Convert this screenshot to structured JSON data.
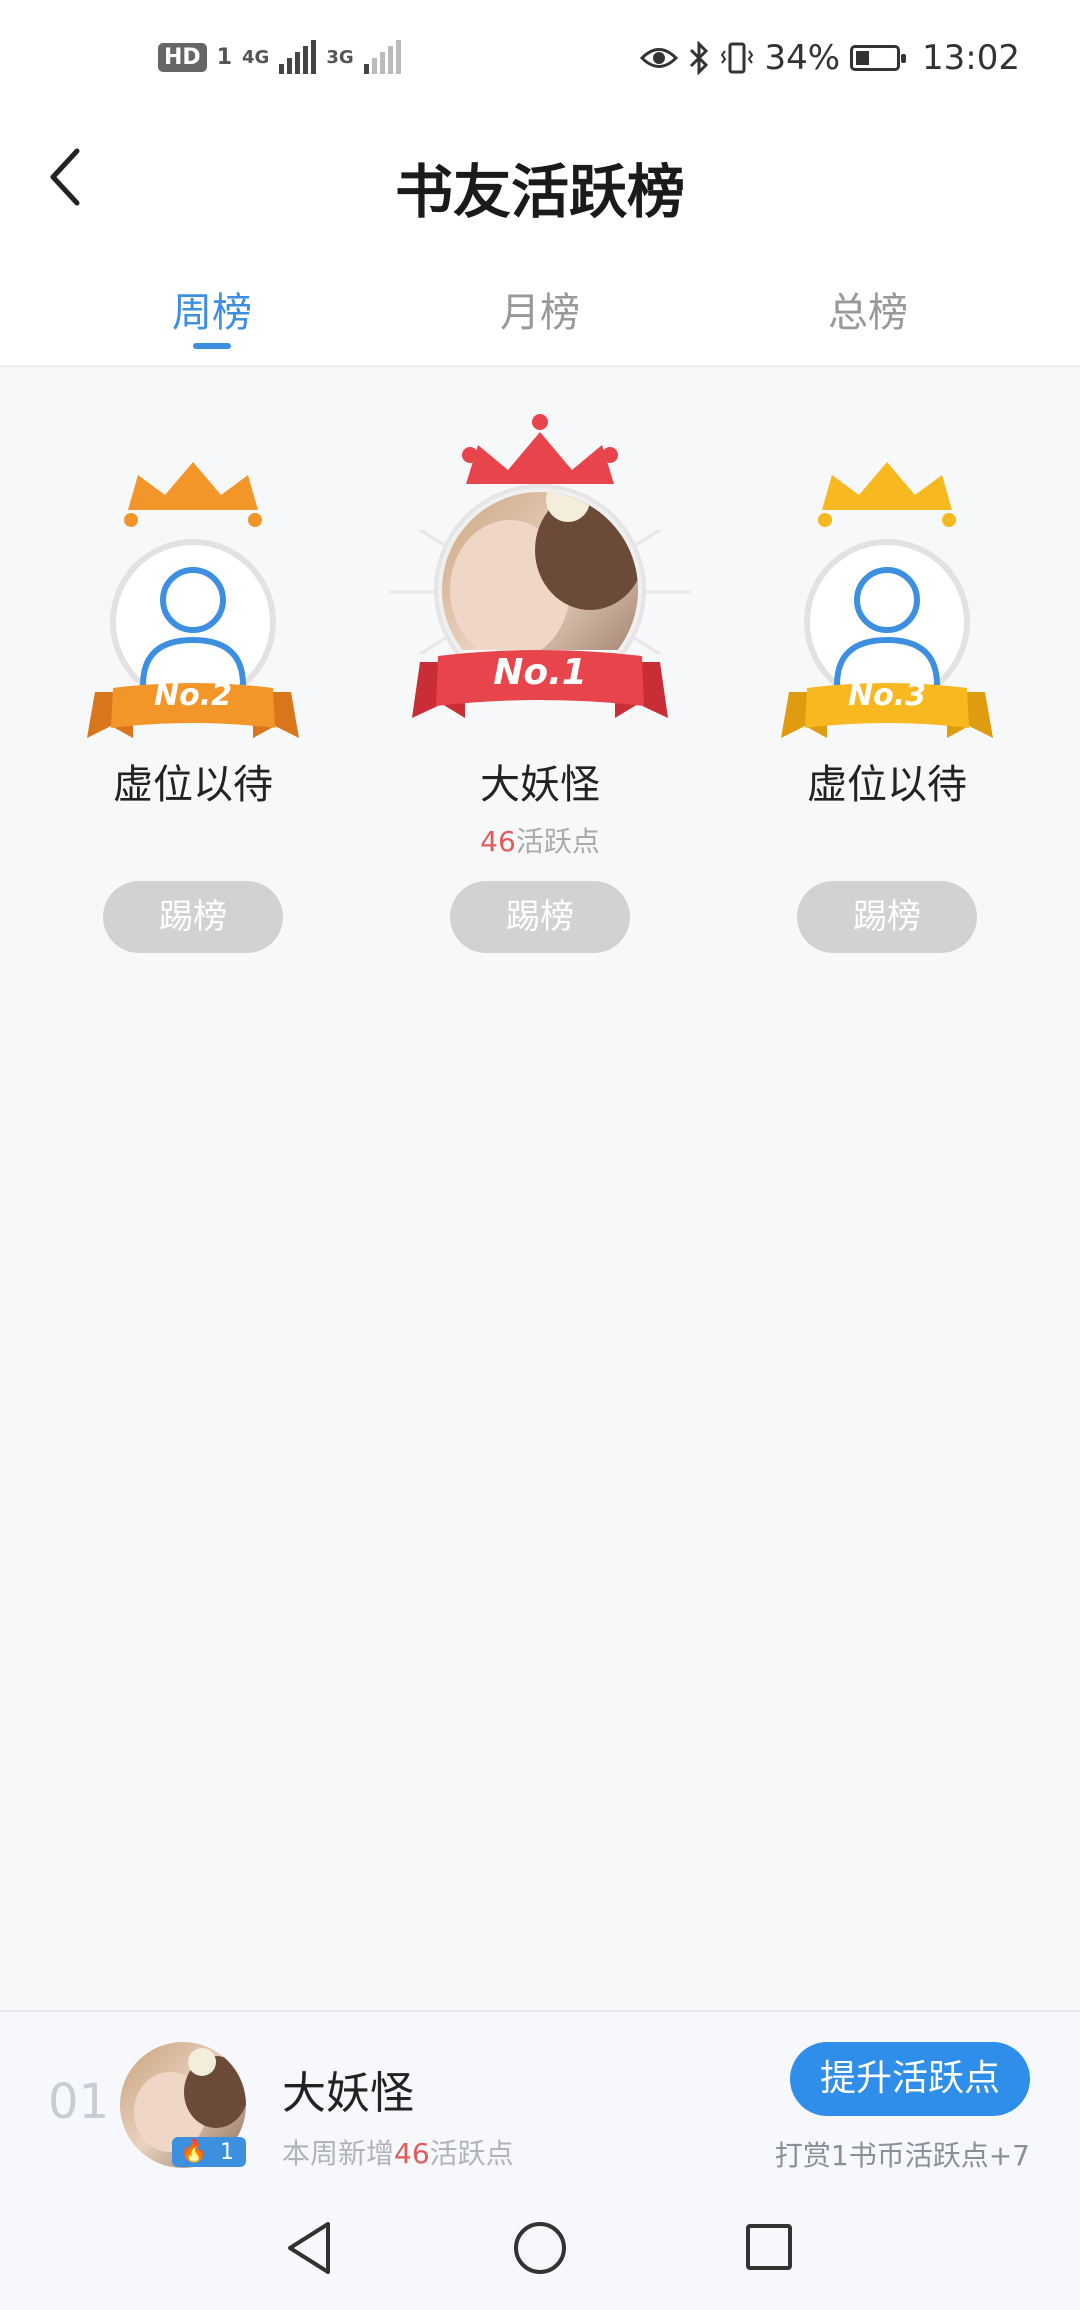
{
  "status_bar": {
    "hd": "HD",
    "hd_sub": "1",
    "net1": "4G",
    "net2": "3G",
    "battery_percent": "34%",
    "battery_level": 0.34,
    "time": "13:02"
  },
  "header": {
    "title": "书友活跃榜"
  },
  "tabs": [
    {
      "label": "周榜",
      "active": true
    },
    {
      "label": "月榜",
      "active": false
    },
    {
      "label": "总榜",
      "active": false
    }
  ],
  "podium": {
    "second": {
      "badge": "No.2",
      "name": "虚位以待",
      "button": "踢榜"
    },
    "first": {
      "badge": "No.1",
      "name": "大妖怪",
      "points": "46",
      "points_suffix": "活跃点",
      "button": "踢榜"
    },
    "third": {
      "badge": "No.3",
      "name": "虚位以待",
      "button": "踢榜"
    }
  },
  "my_rank": {
    "rank": "01",
    "badge_level": "1",
    "name": "大妖怪",
    "sub_prefix": "本周新增",
    "sub_points": "46",
    "sub_suffix": "活跃点",
    "boost_button": "提升活跃点",
    "boost_note": "打赏1书币活跃点+7"
  },
  "nav": {
    "icons": [
      "back-triangle-icon",
      "home-circle-icon",
      "recents-square-icon"
    ]
  },
  "colors": {
    "accent": "#3d8fe0",
    "gold_second": "#f3962a",
    "red_first": "#e8444c",
    "yellow_third": "#f7b820",
    "highlight_number": "#e35a5a"
  }
}
